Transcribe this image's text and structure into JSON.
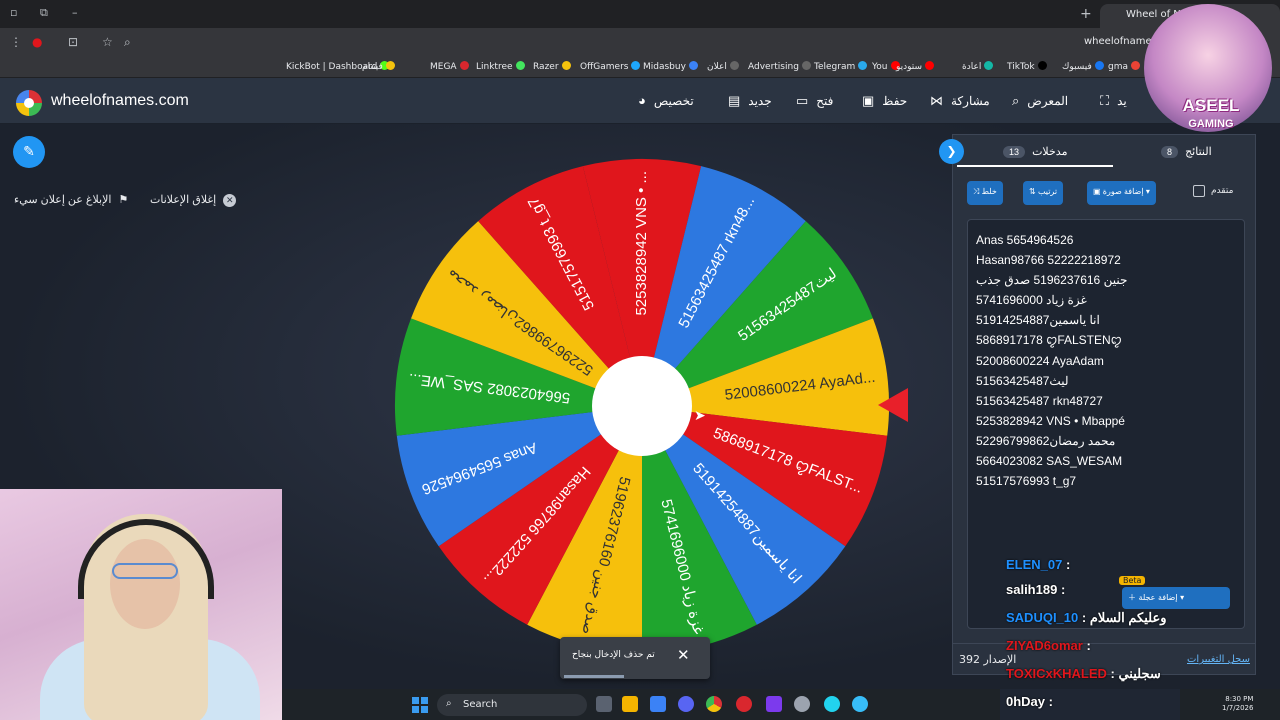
{
  "browser": {
    "tab_title": "Wheel of N",
    "url": "wheelofnames.c",
    "bookmarks": [
      {
        "label": "KickBot | Dashboard",
        "color": "#53fc18"
      },
      {
        "label": "فيتنام",
        "color": "#f4c20d"
      },
      {
        "label": "MEGA",
        "color": "#d9272e"
      },
      {
        "label": "Linktree",
        "color": "#43e55e"
      },
      {
        "label": "Razer",
        "color": "#f4c20d"
      },
      {
        "label": "OffGamers",
        "color": "#1ea7fd"
      },
      {
        "label": "Midasbuy",
        "color": "#3b82f6"
      },
      {
        "label": "اعلان",
        "color": "#666666"
      },
      {
        "label": "Advertising",
        "color": "#666666"
      },
      {
        "label": "Telegram",
        "color": "#29a9eb"
      },
      {
        "label": "You",
        "color": "#ff0000"
      },
      {
        "label": "ستوديو",
        "color": "#ff0000"
      },
      {
        "label": "اعادة",
        "color": "#14b8a6"
      },
      {
        "label": "TikTok",
        "color": "#000000"
      },
      {
        "label": "فيسبوك",
        "color": "#1877f2"
      },
      {
        "label": "gma",
        "color": "#ea4335"
      }
    ]
  },
  "header": {
    "site_name": "wheelofnames.com",
    "nav": [
      {
        "label": "تخصيص",
        "icon": "palette-icon"
      },
      {
        "label": "جديد",
        "icon": "file-icon"
      },
      {
        "label": "فتح",
        "icon": "folder-icon"
      },
      {
        "label": "حفظ",
        "icon": "save-icon"
      },
      {
        "label": "مشاركة",
        "icon": "share-icon"
      },
      {
        "label": "المعرض",
        "icon": "search-icon"
      },
      {
        "label": "يد",
        "icon": "fullscreen-icon"
      }
    ]
  },
  "actions": {
    "report_ad": "الإبلاغ عن إعلان سيء",
    "close_ads": "إغلاق الإعلانات"
  },
  "wheel": {
    "segments": [
      {
        "label": "5253828942 VNS • ...",
        "color": "#e0161c"
      },
      {
        "label": "51563425487 rkn48...",
        "color": "#2d78e0"
      },
      {
        "label": "51563425487ليث",
        "color": "#1fa52e"
      },
      {
        "label": "52008600224 AyaAd...",
        "color": "#f6c00c"
      },
      {
        "label": "5868917178 ꨄFALST...",
        "color": "#e0161c"
      },
      {
        "label": "51914254887انا ياسمين",
        "color": "#2d78e0"
      },
      {
        "label": "5741696000 غزة زياد",
        "color": "#1fa52e"
      },
      {
        "label": "51962376160 صدق جنين",
        "color": "#f6c00c"
      },
      {
        "label": "Hasan98766 522222...",
        "color": "#e0161c"
      },
      {
        "label": "Anas 5654964526",
        "color": "#2d78e0"
      },
      {
        "label": "5664023082 SAS_WE...",
        "color": "#1fa52e"
      },
      {
        "label": "52296799862محمد رمضان",
        "color": "#f6c00c"
      },
      {
        "label": "51517576993 t_g7",
        "color": "#e0161c"
      }
    ]
  },
  "panel": {
    "tab_entries": "مدخلات",
    "entries_count": "13",
    "tab_results": "النتائج",
    "results_count": "8",
    "shuffle_label": "خلط",
    "sort_label": "ترتيب",
    "add_image_label": "إضافة صورة",
    "advanced_label": "متقدم",
    "entries": [
      "Anas 5654964526",
      "Hasan98766 52222218972",
      "جنين 5196237616 صدق جذب",
      "5741696000 غزة زياد",
      "51914254887انا ياسمين",
      "5868917178 ꨄFALSTENꨄ",
      "52008600224 AyaAdam",
      "51563425487ليث",
      "51563425487 rkn48727",
      "5253828942 VNS • Mbappé",
      "52296799862محمد رمضان",
      "5664023082 SAS_WESAM",
      "51517576993 t_g7"
    ],
    "version_label": "الإصدار",
    "version_number": "392",
    "changelog": "سجل التغييرات"
  },
  "quick_add": {
    "label": "إضافة عجلة",
    "beta": "Beta"
  },
  "chat": [
    {
      "user": "ELEN_07",
      "text": "",
      "color": "#1e90ff"
    },
    {
      "user": "salih189",
      "text": "",
      "color": "#ffffff"
    },
    {
      "user": "SADUQI_10",
      "text": "وعليكم السلام",
      "color": "#1e90ff"
    },
    {
      "user": "ZIYAD6omar",
      "text": "",
      "color": "#e0161c"
    },
    {
      "user": "TOXICxKHALED",
      "text": "سجليني",
      "color": "#e0161c"
    },
    {
      "user": "0hDay",
      "text": "",
      "color": "#ffffff"
    }
  ],
  "toast": {
    "message": "تم حذف الإدخال بنجاح"
  },
  "streamer": {
    "name": "ASEEL",
    "subtitle": "GAMING"
  },
  "taskbar": {
    "search": "Search",
    "time": "8:30 PM",
    "date": "1/7/2026"
  }
}
